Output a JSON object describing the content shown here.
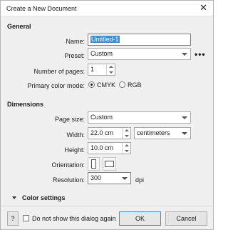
{
  "window": {
    "title": "Create a New Document",
    "close_symbol": "✕"
  },
  "general": {
    "heading": "General",
    "name_label": "Name:",
    "name_value": "Untitled-1",
    "preset_label": "Preset:",
    "preset_value": "Custom",
    "more_symbol": "•••",
    "pages_label": "Number of pages:",
    "pages_value": "1",
    "color_mode_label": "Primary color mode:",
    "color_modes": [
      "CMYK",
      "RGB"
    ],
    "color_mode_selected": "CMYK"
  },
  "dimensions": {
    "heading": "Dimensions",
    "page_size_label": "Page size:",
    "page_size_value": "Custom",
    "width_label": "Width:",
    "width_value": "22.0 cm",
    "units_value": "centimeters",
    "height_label": "Height:",
    "height_value": "10.0 cm",
    "orientation_label": "Orientation:",
    "orientation_selected": "portrait",
    "resolution_label": "Resolution:",
    "resolution_value": "300",
    "resolution_unit": "dpi"
  },
  "color_settings": {
    "label": "Color settings"
  },
  "footer": {
    "help_label": "?",
    "dont_show_label": "Do not show this dialog again",
    "ok_label": "OK",
    "cancel_label": "Cancel"
  }
}
